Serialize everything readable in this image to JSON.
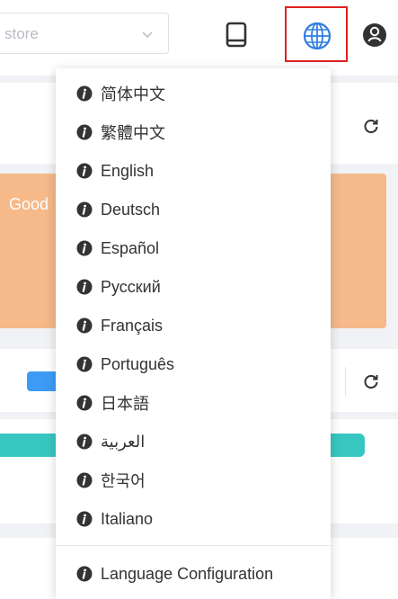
{
  "header": {
    "store_placeholder": "store",
    "icons": {
      "tablet": "tablet-icon",
      "globe": "globe-icon",
      "user": "user-icon",
      "chevron": "chevron-down-icon"
    },
    "highlight_color": "#e02020",
    "globe_color": "#2f7fe0"
  },
  "background": {
    "card_text": "Good",
    "orange_color": "#f5b98a",
    "teal_color": "#38c7c0",
    "blue_color": "#3d9bf5"
  },
  "language_menu": {
    "items": [
      {
        "label": "简体中文"
      },
      {
        "label": "繁體中文"
      },
      {
        "label": "English"
      },
      {
        "label": "Deutsch"
      },
      {
        "label": "Español"
      },
      {
        "label": "Русский"
      },
      {
        "label": "Français"
      },
      {
        "label": "Português"
      },
      {
        "label": "日本語"
      },
      {
        "label": "العربية"
      },
      {
        "label": "한국어"
      },
      {
        "label": "Italiano"
      }
    ],
    "footer_item": {
      "label": "Language Configuration"
    },
    "item_icon": "info-circle-icon"
  }
}
